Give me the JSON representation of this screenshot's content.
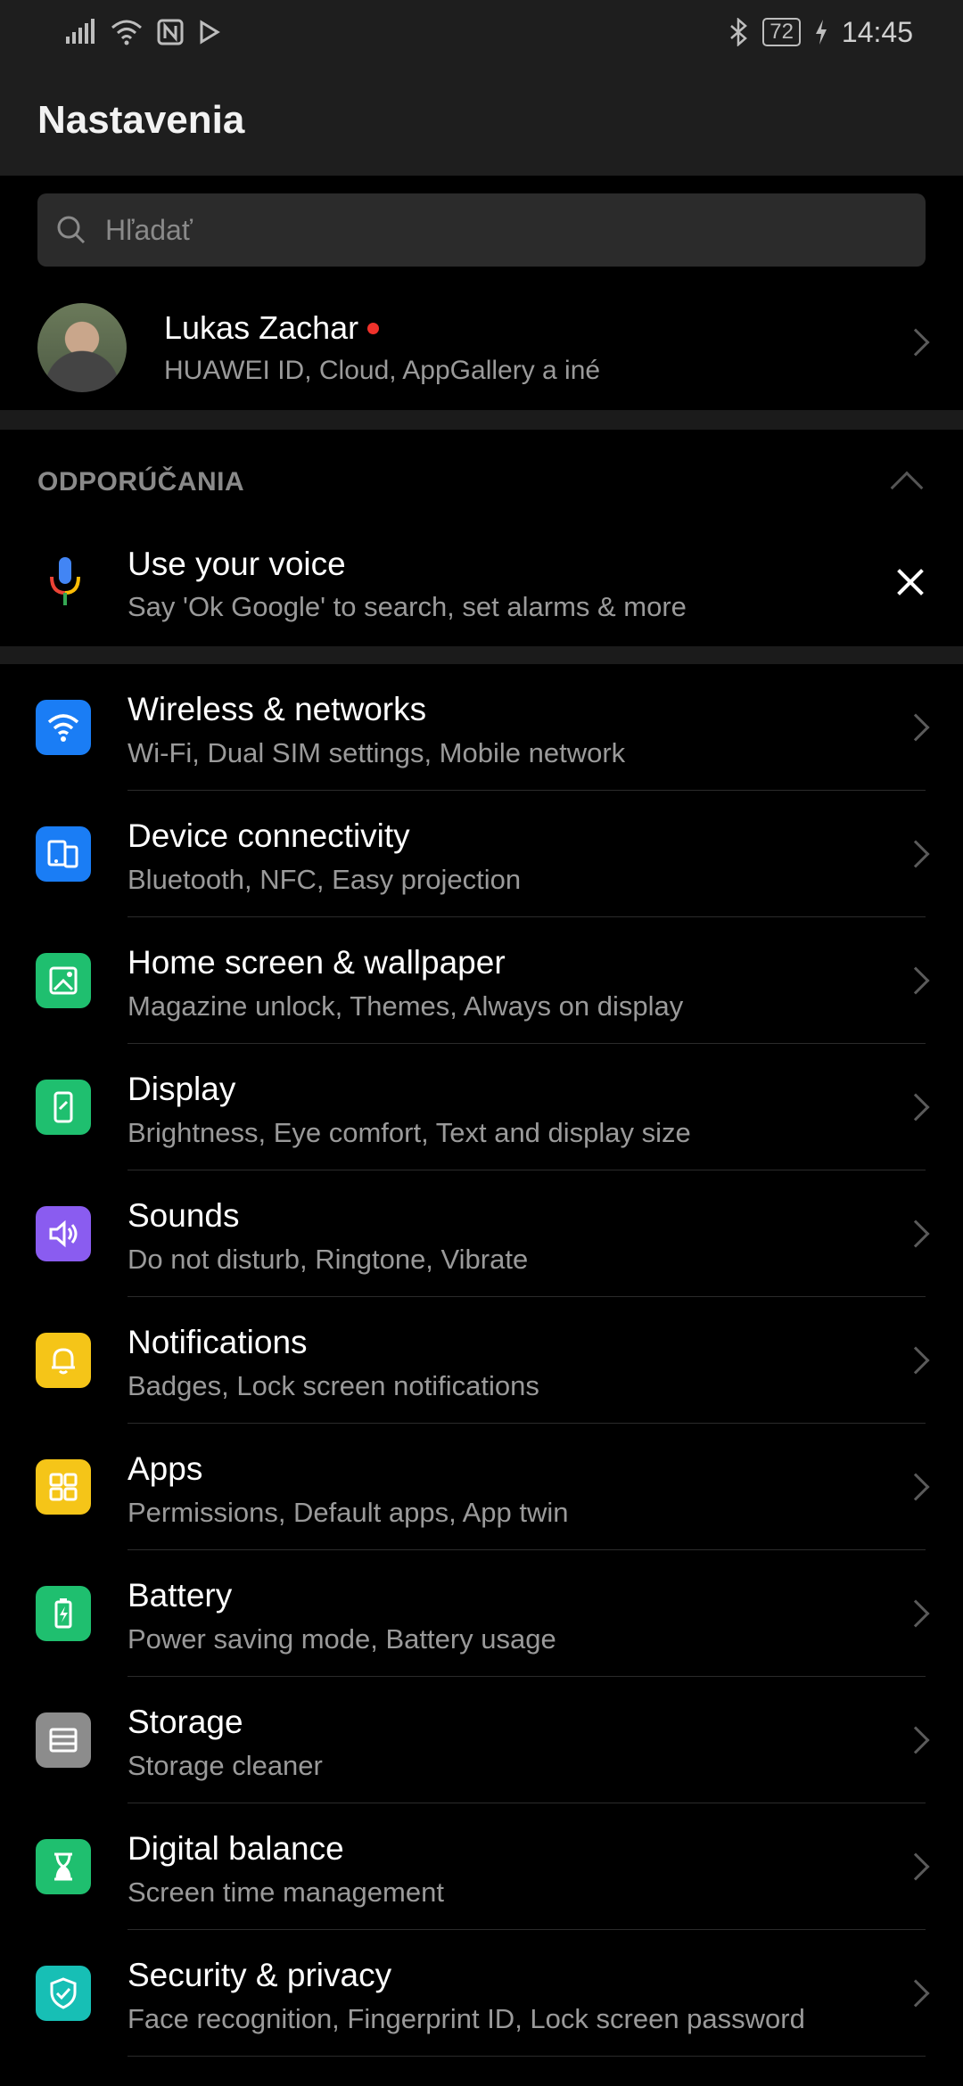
{
  "status_bar": {
    "battery": "72",
    "time": "14:45"
  },
  "header": {
    "title": "Nastavenia"
  },
  "search": {
    "placeholder": "Hľadať"
  },
  "account": {
    "name": "Lukas Zachar",
    "subtitle": "HUAWEI ID, Cloud, AppGallery a iné"
  },
  "suggestions": {
    "heading": "ODPORÚČANIA",
    "card": {
      "title": "Use your voice",
      "subtitle": "Say 'Ok Google' to search, set alarms & more"
    }
  },
  "settings": [
    {
      "title": "Wireless & networks",
      "subtitle": "Wi-Fi, Dual SIM settings, Mobile network",
      "icon": "wifi-icon",
      "color": "#1a7df5"
    },
    {
      "title": "Device connectivity",
      "subtitle": "Bluetooth, NFC, Easy projection",
      "icon": "device-connectivity-icon",
      "color": "#1a7df5"
    },
    {
      "title": "Home screen & wallpaper",
      "subtitle": "Magazine unlock, Themes, Always on display",
      "icon": "wallpaper-icon",
      "color": "#1fbf6f"
    },
    {
      "title": "Display",
      "subtitle": "Brightness, Eye comfort, Text and display size",
      "icon": "display-icon",
      "color": "#1fbf6f"
    },
    {
      "title": "Sounds",
      "subtitle": "Do not disturb, Ringtone, Vibrate",
      "icon": "sound-icon",
      "color": "#8a5cf0"
    },
    {
      "title": "Notifications",
      "subtitle": "Badges, Lock screen notifications",
      "icon": "bell-icon",
      "color": "#f5c518"
    },
    {
      "title": "Apps",
      "subtitle": "Permissions, Default apps, App twin",
      "icon": "apps-grid-icon",
      "color": "#f5c518"
    },
    {
      "title": "Battery",
      "subtitle": "Power saving mode, Battery usage",
      "icon": "battery-icon",
      "color": "#1fbf6f"
    },
    {
      "title": "Storage",
      "subtitle": "Storage cleaner",
      "icon": "storage-icon",
      "color": "#8c8c8c"
    },
    {
      "title": "Digital balance",
      "subtitle": "Screen time management",
      "icon": "hourglass-icon",
      "color": "#1fbf6f"
    },
    {
      "title": "Security & privacy",
      "subtitle": "Face recognition, Fingerprint ID, Lock screen password",
      "icon": "shield-icon",
      "color": "#17bfb5"
    }
  ]
}
